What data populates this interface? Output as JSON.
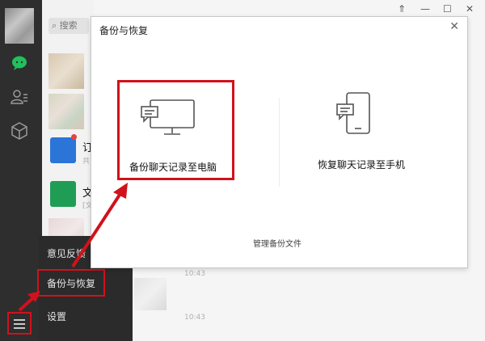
{
  "window": {
    "controls": [
      "⇑",
      "—",
      "☐",
      "✕"
    ]
  },
  "search": {
    "placeholder": "搜索"
  },
  "chat_list": {
    "items": [
      {
        "text": "订",
        "sub": "共"
      },
      {
        "text": "文",
        "sub": "[文"
      }
    ]
  },
  "menu": {
    "items": [
      {
        "label": "意见反馈"
      },
      {
        "label": "备份与恢复"
      },
      {
        "label": "设置"
      }
    ]
  },
  "chat_area": {
    "times": [
      "10:43",
      "10:43"
    ]
  },
  "dialog": {
    "title": "备份与恢复",
    "close": "✕",
    "backup_label": "备份聊天记录至电脑",
    "restore_label": "恢复聊天记录至手机",
    "manage_label": "管理备份文件"
  },
  "colors": {
    "highlight": "#d0121b",
    "sidebar": "#2e2e2e",
    "menu": "#2b2b2b",
    "wechat_green": "#20c05c"
  }
}
